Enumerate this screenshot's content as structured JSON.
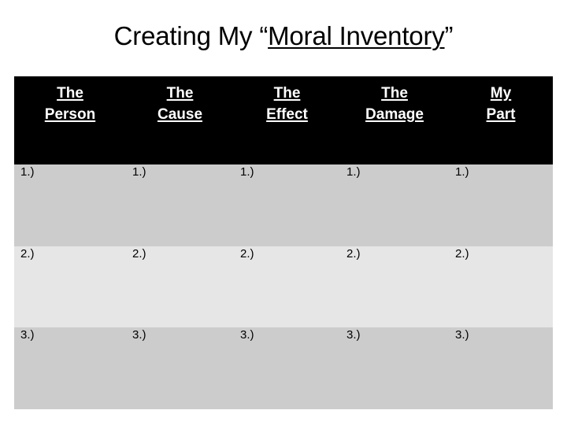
{
  "slide": {
    "background_color": "#ffffff",
    "title": {
      "prefix": "Creating My “",
      "underlined": "Moral Inventory",
      "suffix": "”"
    }
  },
  "table": {
    "header_background": "#000000",
    "header_color": "#ffffff",
    "row_shades": [
      "#cccccc",
      "#e6e6e6",
      "#cccccc"
    ],
    "gridline_color": "#ffffff",
    "columns": [
      {
        "line1": "The",
        "line2": "Person"
      },
      {
        "line1": "The",
        "line2": "Cause"
      },
      {
        "line1": "The",
        "line2": "Effect"
      },
      {
        "line1": "The",
        "line2": "Damage"
      },
      {
        "line1": "My",
        "line2": "Part"
      }
    ],
    "rows": [
      {
        "cells": [
          "1.)",
          "1.)",
          "1.)",
          "1.)",
          "1.)"
        ]
      },
      {
        "cells": [
          "2.)",
          "2.)",
          "2.)",
          "2.)",
          "2.)"
        ]
      },
      {
        "cells": [
          "3.)",
          "3.)",
          "3.)",
          "3.)",
          "3.)"
        ]
      }
    ]
  }
}
